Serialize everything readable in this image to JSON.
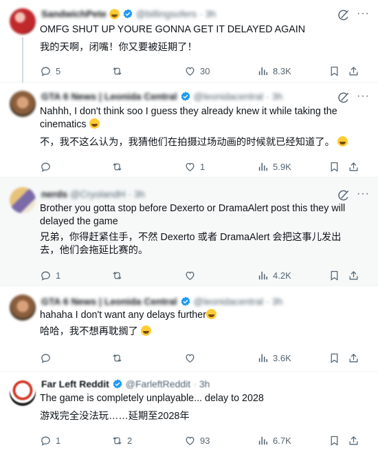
{
  "colors": {
    "text": "#0f1419",
    "muted": "#536471",
    "verified": "#1d9bf0",
    "divider": "#eff3f4",
    "highlight": "#f7f9f9"
  },
  "posts": [
    {
      "name": "SandwichPete",
      "handle": "@billingsofers",
      "time": "3h",
      "badge_icons": [
        "emoji-badge-icon",
        "verified-badge-icon"
      ],
      "text_en": "OMFG SHUT UP YOURE GONNA GET IT DELAYED AGAIN",
      "text_zh": "我的天啊，闭嘴！你又要被延期了！",
      "replies": "5",
      "reposts": "",
      "likes": "30",
      "views": "8.3K"
    },
    {
      "name": "GTA 6 News | Leonida Central",
      "handle": "@leonidacentral",
      "time": "3h",
      "badge_icons": [
        "verified-badge-icon"
      ],
      "text_en": "Nahhh, I don't think soo I guess they already knew it while taking the cinematics",
      "text_zh": "不，我不这么认为，我猜他们在拍摄过场动画的时候就已经知道了。",
      "replies": "",
      "reposts": "",
      "likes": "1",
      "views": "5.9K"
    },
    {
      "name": "nerds",
      "handle": "@CryolandH",
      "time": "3h",
      "badge_icons": [],
      "text_en": "Brother you gotta stop before Dexerto or DramaAlert post this they will delayed the game",
      "text_zh": "兄弟，你得赶紧住手，不然 Dexerto 或者 DramaAlert 会把这事儿发出去，他们会拖延比赛的。",
      "replies": "1",
      "reposts": "",
      "likes": "",
      "views": "4.2K"
    },
    {
      "name": "GTA 6 News | Leonida Central",
      "handle": "@leonidacentral",
      "time": "3h",
      "badge_icons": [
        "verified-badge-icon"
      ],
      "text_en": "hahaha I don't want any delays further",
      "text_zh": "哈哈，我不想再耽搁了",
      "replies": "",
      "reposts": "",
      "likes": "",
      "views": "3.6K"
    },
    {
      "name": "Far Left Reddit",
      "handle": "@FarleftReddit",
      "time": "3h",
      "badge_icons": [
        "verified-badge-icon"
      ],
      "text_en": "The game is completely unplayable... delay to 2028",
      "text_zh": "游戏完全没法玩……延期至2028年",
      "replies": "1",
      "reposts": "2",
      "likes": "93",
      "views": "6.7K"
    }
  ]
}
